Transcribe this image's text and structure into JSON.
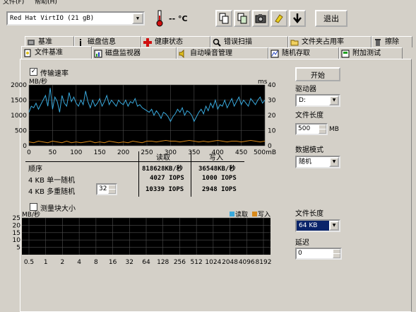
{
  "menu": [
    "文件(F)",
    "帮助(H)"
  ],
  "toolbar": {
    "drive_label": "Red Hat VirtIO (21 gB)",
    "temperature": "-- °C",
    "icons": [
      "copy-icon",
      "copy-screen-icon",
      "camera-icon",
      "options-icon",
      "save-icon"
    ],
    "exit_label": "退出"
  },
  "tabs_top": [
    {
      "label": "基准",
      "icon": "benchmark-icon"
    },
    {
      "label": "磁盘信息",
      "icon": "info-icon"
    },
    {
      "label": "健康状态",
      "icon": "health-icon"
    },
    {
      "label": "错误扫描",
      "icon": "scan-icon"
    },
    {
      "label": "文件夹占用率",
      "icon": "folder-icon"
    },
    {
      "label": "擦除",
      "icon": "erase-icon"
    }
  ],
  "tabs_bottom": [
    {
      "label": "文件基准",
      "icon": "file-benchmark-icon",
      "active": true
    },
    {
      "label": "磁盘监视器",
      "icon": "monitor-icon"
    },
    {
      "label": "自动噪音管理",
      "icon": "speaker-icon"
    },
    {
      "label": "随机存取",
      "icon": "random-access-icon"
    },
    {
      "label": "附加测试",
      "icon": "extra-tests-icon"
    }
  ],
  "transfer": {
    "checkbox_label": "传输速率",
    "checked": "✓",
    "left_unit": "MB/秒",
    "right_unit": "ms",
    "x_unit": "mB"
  },
  "chart_data": [
    {
      "type": "line",
      "title": "",
      "xlabel": "",
      "ylabel": "MB/秒",
      "x_ticks": [
        "0",
        "50",
        "100",
        "150",
        "200",
        "250",
        "300",
        "350",
        "400",
        "450",
        "500mB"
      ],
      "y_ticks_left": [
        "0",
        "500",
        "1000",
        "1500",
        "2000"
      ],
      "y_ticks_right": [
        "0",
        "10",
        "20",
        "30",
        "40"
      ],
      "xlim": [
        0,
        500
      ],
      "ylim": [
        0,
        2000
      ],
      "y2lim": [
        0,
        40
      ],
      "grid": true,
      "series": [
        {
          "color": "#39a9dc",
          "x": [
            0,
            5,
            10,
            15,
            20,
            25,
            30,
            35,
            40,
            45,
            50,
            55,
            60,
            65,
            70,
            75,
            80,
            85,
            90,
            95,
            100,
            105,
            110,
            115,
            120,
            125,
            130,
            135,
            140,
            145,
            150,
            155,
            160,
            165,
            170,
            175,
            180,
            185,
            190,
            195,
            200,
            205,
            210,
            215,
            220,
            225,
            230,
            235,
            240,
            245,
            250,
            255,
            260,
            265,
            270,
            275,
            280,
            285,
            290,
            295,
            300,
            305,
            310,
            315,
            320,
            325,
            330,
            335,
            340,
            345,
            350,
            355,
            360,
            365,
            370,
            375,
            380,
            385,
            390,
            395,
            400,
            405,
            410,
            415,
            420,
            425,
            430,
            435,
            440,
            445,
            450,
            455,
            460,
            465,
            470,
            475,
            480,
            485,
            490,
            495,
            500
          ],
          "y": [
            1100,
            1300,
            1250,
            1400,
            1200,
            1350,
            1500,
            1650,
            1300,
            1900,
            1200,
            1600,
            1450,
            1100,
            1650,
            1400,
            1300,
            1750,
            1450,
            1600,
            1400,
            1300,
            1500,
            1350,
            1800,
            1450,
            1250,
            1500,
            1300,
            1400,
            1550,
            1300,
            1450,
            1650,
            1350,
            1500,
            1400,
            1300,
            1500,
            1400,
            1350,
            1500,
            1300,
            1450,
            1400,
            1550,
            1300,
            1350,
            1250,
            1200,
            1150,
            1100,
            1200,
            1000,
            1150,
            1050,
            900,
            1100,
            1050,
            950,
            800,
            950,
            1050,
            1200,
            1100,
            1250,
            1000,
            1150,
            1100,
            1000,
            800,
            950,
            1100,
            1200,
            1050,
            1300,
            1150,
            1400,
            1250,
            1500,
            1200,
            1350,
            1300,
            1500,
            1250,
            1400,
            1550,
            1300,
            1450,
            1600,
            1350,
            1500,
            1400,
            1300,
            1550,
            1450,
            1350,
            1500,
            1600,
            1400,
            1500
          ]
        },
        {
          "color": "#d98a1b",
          "x": [
            0,
            10,
            20,
            30,
            40,
            50,
            60,
            70,
            80,
            90,
            100,
            110,
            120,
            130,
            140,
            150,
            160,
            170,
            180,
            190,
            200,
            210,
            220,
            230,
            240,
            250,
            260,
            270,
            280,
            290,
            300,
            310,
            320,
            330,
            340,
            350,
            360,
            370,
            380,
            390,
            400,
            410,
            420,
            430,
            440,
            450,
            460,
            470,
            480,
            490,
            500
          ],
          "y": [
            2.5,
            2,
            3,
            2.5,
            2,
            3,
            2.5,
            2,
            3,
            2,
            2.5,
            2,
            2.5,
            3,
            2,
            2.5,
            2,
            3,
            2.5,
            2,
            2.5,
            2,
            3,
            2.5,
            2,
            3,
            3,
            2.5,
            3,
            3.5,
            3,
            3,
            2.5,
            3,
            3.5,
            3,
            2.5,
            3,
            2.5,
            3,
            3.5,
            3,
            2.5,
            3,
            3,
            2.5,
            3,
            3.5,
            3,
            2.5,
            3
          ]
        }
      ]
    },
    {
      "type": "bar",
      "title": "",
      "ylabel": "MB/秒",
      "categories": [
        "0.5",
        "1",
        "2",
        "4",
        "8",
        "16",
        "32",
        "64",
        "128",
        "256",
        "512",
        "1024",
        "2048",
        "4096",
        "8192"
      ],
      "y_ticks": [
        "5",
        "10",
        "15",
        "20",
        "25"
      ],
      "ylim": [
        0,
        25
      ],
      "grid": true,
      "series": [
        {
          "name": "读取",
          "color": "#39a9dc",
          "values": []
        },
        {
          "name": "写入",
          "color": "#d98a1b",
          "values": []
        }
      ],
      "legend": "top-right"
    }
  ],
  "results": {
    "header_read": "读取",
    "header_write": "写入",
    "rows": [
      {
        "label": "顺序",
        "read": "818628KB/秒",
        "write": "36548KB/秒"
      },
      {
        "label": "4 KB 单一随机",
        "read": "4027 IOPS",
        "write": "1000 IOPS"
      },
      {
        "label": "4 KB 多重随机",
        "queue": "32",
        "read": "10339 IOPS",
        "write": "2948 IOPS"
      }
    ]
  },
  "sidebar": {
    "start_label": "开始",
    "drive_label": "驱动器",
    "drive_value": "D:",
    "file_length_label": "文件长度",
    "file_length_value": "500",
    "file_length_unit": "MB",
    "data_mode_label": "数据模式",
    "data_mode_value": "随机"
  },
  "blocksize": {
    "checkbox_label": "测量块大小",
    "file_length_label": "文件长度",
    "file_length_value": "64 KB",
    "delay_label": "延迟",
    "delay_value": "0"
  }
}
